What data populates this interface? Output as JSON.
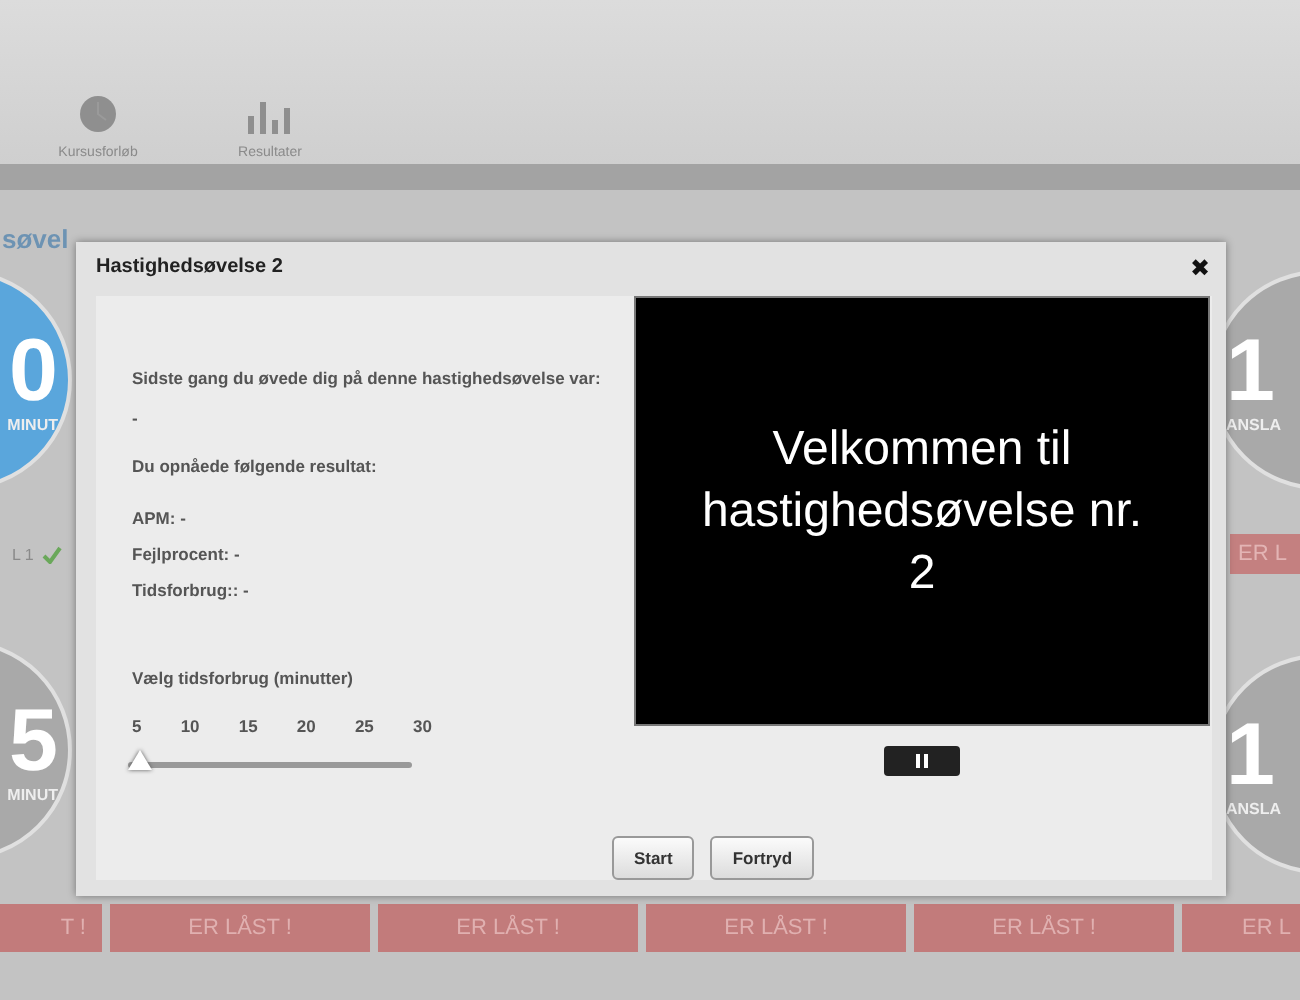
{
  "nav": {
    "items": [
      {
        "label": "Kursusforløb",
        "kind": "clock"
      },
      {
        "label": "Resultater",
        "kind": "bars"
      }
    ]
  },
  "background": {
    "heading": "søvel",
    "left_tiles": [
      {
        "number": "0",
        "unit": "MINUT",
        "color": "#5aa6dc"
      },
      {
        "number": "5",
        "unit": "MINUT",
        "color": "#a9a9a9"
      }
    ],
    "level_label": "L 1",
    "right_tiles": [
      {
        "number": "1",
        "unit": "ANSLA"
      },
      {
        "number": "1",
        "unit": "ANSLA"
      }
    ],
    "right_locked": "ER L",
    "locked_buttons": [
      "T !",
      "ER LÅST !",
      "ER LÅST !",
      "ER LÅST !",
      "ER LÅST !",
      "ER L"
    ]
  },
  "dialog": {
    "title": "Hastighedsøvelse 2",
    "close": "✖",
    "last_time": "Sidste gang du øvede dig på denne hastighedsøvelse var:",
    "last_value": "-",
    "result_heading": "Du opnåede følgende resultat:",
    "results": [
      "APM: -",
      "Fejlprocent: -",
      "Tidsforbrug:: -"
    ],
    "slider": {
      "label": "Vælg tidsforbrug (minutter)",
      "ticks": [
        "5",
        "10",
        "15",
        "20",
        "25",
        "30"
      ],
      "level": 0
    },
    "video": {
      "text": "Velkommen til hastighedsøvelse nr. 2"
    },
    "buttons": [
      "Start",
      "Fortryd"
    ]
  }
}
